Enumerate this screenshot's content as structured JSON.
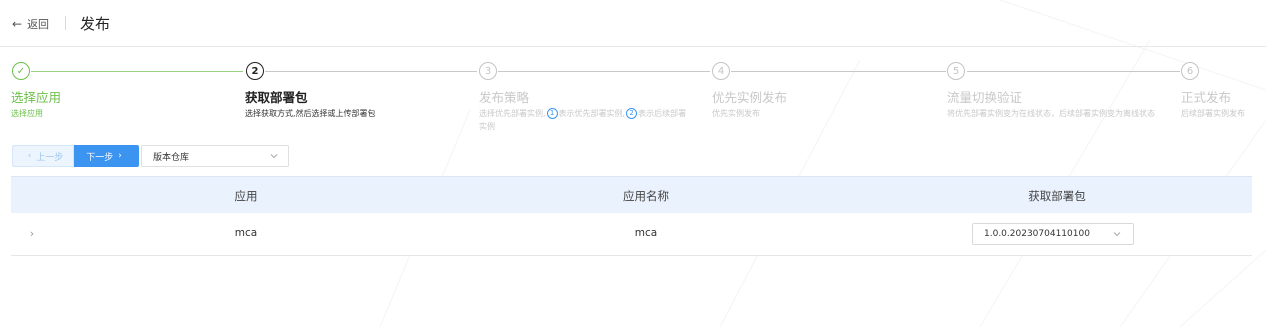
{
  "header": {
    "back_label": "返回",
    "title": "发布"
  },
  "steps": [
    {
      "index": "✓",
      "title": "选择应用",
      "desc": "选择应用",
      "state": "done"
    },
    {
      "index": "2",
      "title": "获取部署包",
      "desc": "选择获取方式,然后选择或上传部署包",
      "state": "active"
    },
    {
      "index": "3",
      "title": "发布策略",
      "desc_part1": "选择优先部署实例,",
      "desc_mark1": "1",
      "desc_part2": "表示优先部署实例,",
      "desc_mark2": "2",
      "desc_part3": "表示后续部署实例",
      "state": "pending"
    },
    {
      "index": "4",
      "title": "优先实例发布",
      "desc": "优先实例发布",
      "state": "pending"
    },
    {
      "index": "5",
      "title": "流量切换验证",
      "desc": "将优先部署实例变为在线状态，后续部署实例变为离线状态",
      "state": "pending"
    },
    {
      "index": "6",
      "title": "正式发布",
      "desc": "后续部署实例发布",
      "state": "pending"
    }
  ],
  "actions": {
    "prev_label": "上一步",
    "next_label": "下一步",
    "repo_select_value": "版本仓库"
  },
  "table": {
    "columns": [
      "应用",
      "应用名称",
      "获取部署包"
    ],
    "rows": [
      {
        "app": "mca",
        "app_name": "mca",
        "package": "1.0.0.20230704110100"
      }
    ]
  },
  "colors": {
    "accent": "#3b94f0",
    "success": "#6cc04a",
    "header_bg": "#eaf2fd"
  }
}
